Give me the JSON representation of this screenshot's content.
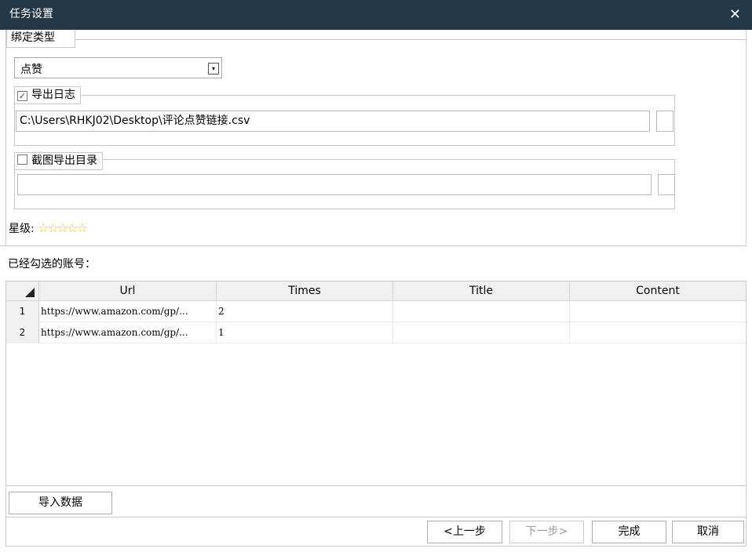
{
  "window": {
    "title": "任务设置",
    "close_icon": "✕"
  },
  "bind_type": {
    "label": "绑定类型",
    "selected": "点赞",
    "dropdown_icon": "▾"
  },
  "export_log": {
    "checked": true,
    "label": "导出日志",
    "path": "C:\\Users\\RHKJ02\\Desktop\\评论点赞链接.csv"
  },
  "screenshot_dir": {
    "checked": false,
    "label": "截图导出目录",
    "path": ""
  },
  "rating": {
    "label": "星级:",
    "stars": "☆☆☆☆☆",
    "value": 0,
    "max": 5
  },
  "accounts": {
    "label": "已经勾选的账号："
  },
  "table": {
    "columns": [
      "Url",
      "Times",
      "Title",
      "Content"
    ],
    "rows": [
      {
        "index": "1",
        "url": "https://www.amazon.com/gp/...",
        "times": "2",
        "title": "",
        "content": ""
      },
      {
        "index": "2",
        "url": "https://www.amazon.com/gp/...",
        "times": "1",
        "title": "",
        "content": ""
      }
    ]
  },
  "buttons": {
    "import": "导入数据",
    "prev": "<上一步",
    "next": "下一步>",
    "finish": "完成",
    "cancel": "取消"
  },
  "colors": {
    "titlebar": "#243746",
    "star": "#f1b81c"
  }
}
